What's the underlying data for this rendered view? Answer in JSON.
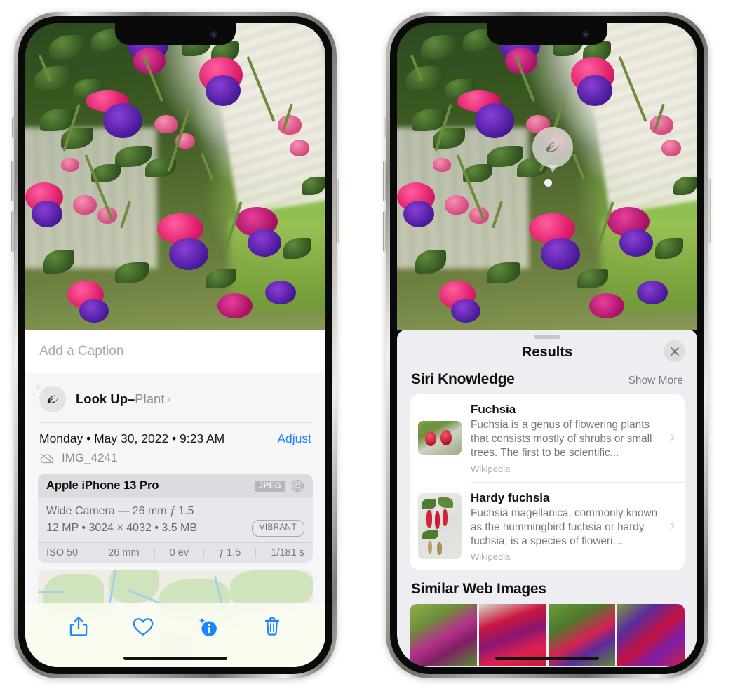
{
  "left_phone": {
    "photo": {
      "name": "fuchsia-flowers-photo",
      "alt": "Hanging fuchsia flowers with pink sepals and purple corollas"
    },
    "caption": {
      "placeholder": "Add a Caption",
      "value": ""
    },
    "lookup": {
      "icon": "leaf-icon",
      "label": "Look Up",
      "dash": " – ",
      "subject": "Plant",
      "chevron": "›"
    },
    "date": {
      "weekday": "Monday",
      "full": "Monday • May 30, 2022 • 9:23 AM",
      "adjust_label": "Adjust"
    },
    "file": {
      "icon": "cloud-slash-icon",
      "name": "IMG_4241"
    },
    "exif": {
      "model": "Apple iPhone 13 Pro",
      "format_badge": "JPEG",
      "aperture_icon": "aperture-icon",
      "lens_line": "Wide Camera — 26 mm ƒ 1.5",
      "size_line": "12 MP • 3024 × 4032 • 3.5 MB",
      "style_badge": "VIBRANT",
      "stats": [
        {
          "label": "ISO 50"
        },
        {
          "label": "26 mm"
        },
        {
          "label": "0 ev"
        },
        {
          "label": "ƒ 1.5"
        },
        {
          "label": "1/181 s"
        }
      ]
    },
    "map": {
      "name": "location-map",
      "pin": "photo-pin"
    },
    "toolbar": [
      {
        "name": "share-button",
        "icon": "share-icon"
      },
      {
        "name": "favorite-button",
        "icon": "heart-icon"
      },
      {
        "name": "info-button",
        "icon": "info-sparkle-icon"
      },
      {
        "name": "delete-button",
        "icon": "trash-icon"
      }
    ],
    "accent_color": "#1b84ff"
  },
  "right_phone": {
    "photo": {
      "name": "fuchsia-flowers-photo",
      "alt": "Hanging fuchsia flowers with visual look up badge"
    },
    "badge": {
      "icon": "leaf-icon",
      "name": "visual-lookup-badge"
    },
    "sheet": {
      "grabber": "sheet-grabber",
      "title": "Results",
      "close_icon": "close-icon"
    },
    "siri_knowledge": {
      "title": "Siri Knowledge",
      "show_more": "Show More",
      "cards": [
        {
          "title": "Fuchsia",
          "description": "Fuchsia is a genus of flowering plants that consists mostly of shrubs or small trees. The first to be scientific...",
          "source": "Wikipedia",
          "chevron": "›"
        },
        {
          "title": "Hardy fuchsia",
          "description": "Fuchsia magellanica, commonly known as the hummingbird fuchsia or hardy fuchsia, is a species of floweri...",
          "source": "Wikipedia",
          "chevron": "›"
        }
      ]
    },
    "similar_web_images": {
      "title": "Similar Web Images",
      "thumbnails": [
        {
          "name": "web-image-1",
          "alt": "pink and magenta fuchsia with green leaves"
        },
        {
          "name": "web-image-2",
          "alt": "red and magenta fuchsia close up"
        },
        {
          "name": "web-image-3",
          "alt": "fuchsia bush with red buds"
        },
        {
          "name": "web-image-4",
          "alt": "purple and red fuchsia blooms"
        }
      ]
    }
  }
}
